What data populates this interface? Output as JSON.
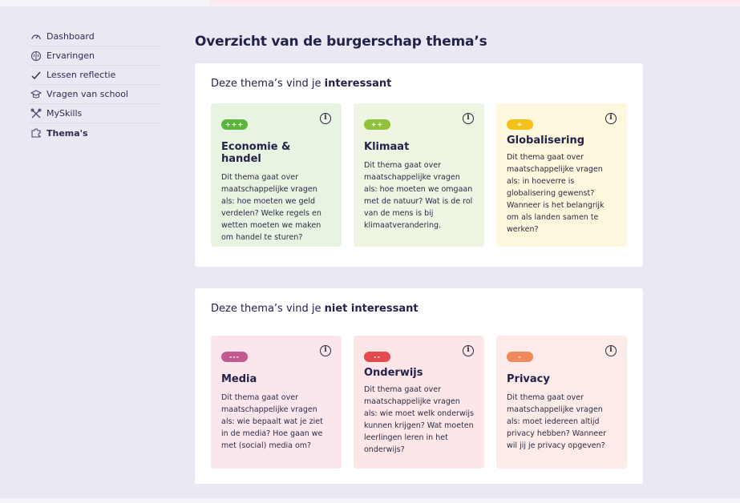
{
  "sidebar": {
    "items": [
      {
        "label": "Dashboard",
        "icon": "gauge-icon"
      },
      {
        "label": "Ervaringen",
        "icon": "brain-icon"
      },
      {
        "label": "Lessen reflectie",
        "icon": "check-icon"
      },
      {
        "label": "Vragen van school",
        "icon": "graduation-cap-icon"
      },
      {
        "label": "MySkills",
        "icon": "tools-icon"
      },
      {
        "label": "Thema's",
        "icon": "puzzle-icon",
        "active": true
      }
    ]
  },
  "main": {
    "title": "Overzicht van de burgerschap thema’s",
    "interesting": {
      "heading_prefix": "Deze thema’s vind je ",
      "heading_bold": "interessant",
      "cards": [
        {
          "badge": "+++",
          "badge_color": "#5bb53c",
          "title": "Economie & handel",
          "text": "Dit thema gaat over maatschappelijke vragen als: hoe moeten we geld verdelen? Welke regels en wetten moeten we maken om handel te sturen?",
          "info": "i"
        },
        {
          "badge": "++",
          "badge_color": "#8fc23a",
          "title": "Klimaat",
          "text": "Dit thema gaat over maatschappelijke vragen als: hoe moeten we omgaan met de natuur? Wat is de rol van de mens is bij klimaatverandering.",
          "info": "i"
        },
        {
          "badge": "+",
          "badge_color": "#f2c21a",
          "title": "Globalisering",
          "text": "Dit thema gaat over maatschappelijke vragen als: in hoeverre is globalisering gewenst? Wanneer is het belangrijk om als landen samen te werken?",
          "info": "i"
        }
      ]
    },
    "not_interesting": {
      "heading_prefix": "Deze thema’s vind je ",
      "heading_bold": "niet interessant",
      "cards": [
        {
          "badge": "---",
          "badge_color": "#c05a8f",
          "title": "Media",
          "text": "Dit thema gaat over maatschappelijke vragen als: wie bepaalt wat je ziet in de media? Hoe gaan we met (social) media om?",
          "info": "i"
        },
        {
          "badge": "--",
          "badge_color": "#e24a4d",
          "title": "Onderwijs",
          "text": " Dit thema gaat over maatschappelijke vragen als: wie moet welk onderwijs kunnen krijgen? Wat moeten leerlingen leren in het onderwijs?",
          "info": "i"
        },
        {
          "badge": "-",
          "badge_color": "#ee8a5b",
          "title": "Privacy",
          "text": "Dit thema gaat over maatschappelijke vragen als: moet iedereen altijd privacy hebben? Wanneer wil jij je privacy opgeven?",
          "info": "i"
        }
      ]
    }
  }
}
